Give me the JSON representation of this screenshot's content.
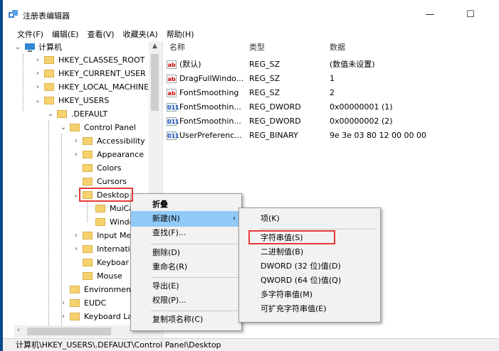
{
  "window": {
    "title": "注册表编辑器",
    "minimize": "—",
    "maximize": "☐"
  },
  "menu": [
    "文件(F)",
    "编辑(E)",
    "查看(V)",
    "收藏夹(A)",
    "帮助(H)"
  ],
  "tree": {
    "root": "计算机",
    "items": [
      "HKEY_CLASSES_ROOT",
      "HKEY_CURRENT_USER",
      "HKEY_LOCAL_MACHINE",
      "HKEY_USERS",
      ".DEFAULT",
      "Control Panel",
      "Accessibility",
      "Appearance",
      "Colors",
      "Cursors",
      "Desktop",
      "MuiCa",
      "Windo",
      "Input Me",
      "Internatio",
      "Keyboar",
      "Mouse",
      "Environment",
      "EUDC",
      "Keyboard La"
    ]
  },
  "list": {
    "columns": [
      "名称",
      "类型",
      "数据"
    ],
    "rows": [
      {
        "icon": "ab",
        "name": "(默认)",
        "type": "REG_SZ",
        "data": "(数值未设置)"
      },
      {
        "icon": "ab",
        "name": "DragFullWindo...",
        "type": "REG_SZ",
        "data": "1"
      },
      {
        "icon": "ab",
        "name": "FontSmoothing",
        "type": "REG_SZ",
        "data": "2"
      },
      {
        "icon": "011",
        "name": "FontSmoothin...",
        "type": "REG_DWORD",
        "data": "0x00000001 (1)"
      },
      {
        "icon": "011",
        "name": "FontSmoothin...",
        "type": "REG_DWORD",
        "data": "0x00000002 (2)"
      },
      {
        "icon": "011",
        "name": "UserPreferenc...",
        "type": "REG_BINARY",
        "data": "9e 3e 03 80 12 00 00 00"
      }
    ]
  },
  "context_menu": {
    "collapse": "折叠",
    "new": "新建(N)",
    "find": "查找(F)...",
    "delete": "删除(D)",
    "rename": "重命名(R)",
    "export": "导出(E)",
    "permissions": "权限(P)...",
    "copy_key_name": "复制项名称(C)"
  },
  "submenu": [
    "项(K)",
    "字符串值(S)",
    "二进制值(B)",
    "DWORD (32 位)值(D)",
    "QWORD (64 位)值(Q)",
    "多字符串值(M)",
    "可扩充字符串值(E)"
  ],
  "status": "计算机\\HKEY_USERS\\.DEFAULT\\Control Panel\\Desktop",
  "colors": {
    "highlight": "#91c9f7",
    "callout": "#e53935",
    "folder": "#f6d26f"
  }
}
